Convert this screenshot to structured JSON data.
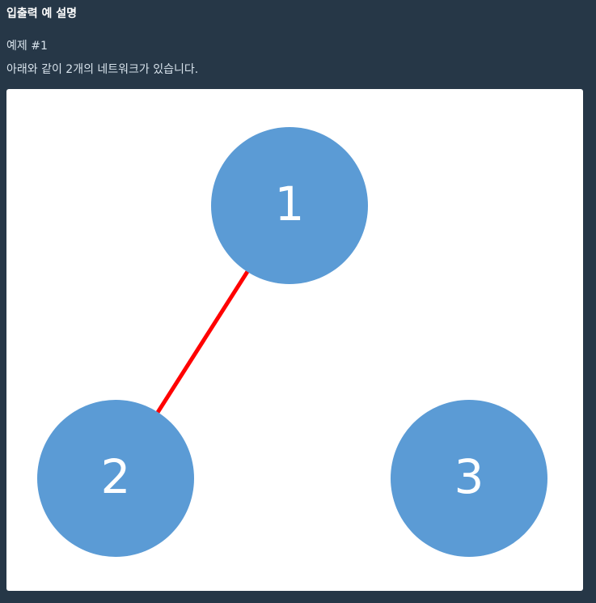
{
  "section": {
    "title": "입출력 예 설명"
  },
  "example": {
    "title": "예제 #1",
    "description": "아래와 같이 2개의 네트워크가 있습니다."
  },
  "diagram": {
    "node_color": "#5b9bd5",
    "edge_color": "#ff0000",
    "nodes": [
      {
        "id": "1",
        "label": "1"
      },
      {
        "id": "2",
        "label": "2"
      },
      {
        "id": "3",
        "label": "3"
      }
    ],
    "edges": [
      {
        "from": "1",
        "to": "2"
      }
    ]
  }
}
